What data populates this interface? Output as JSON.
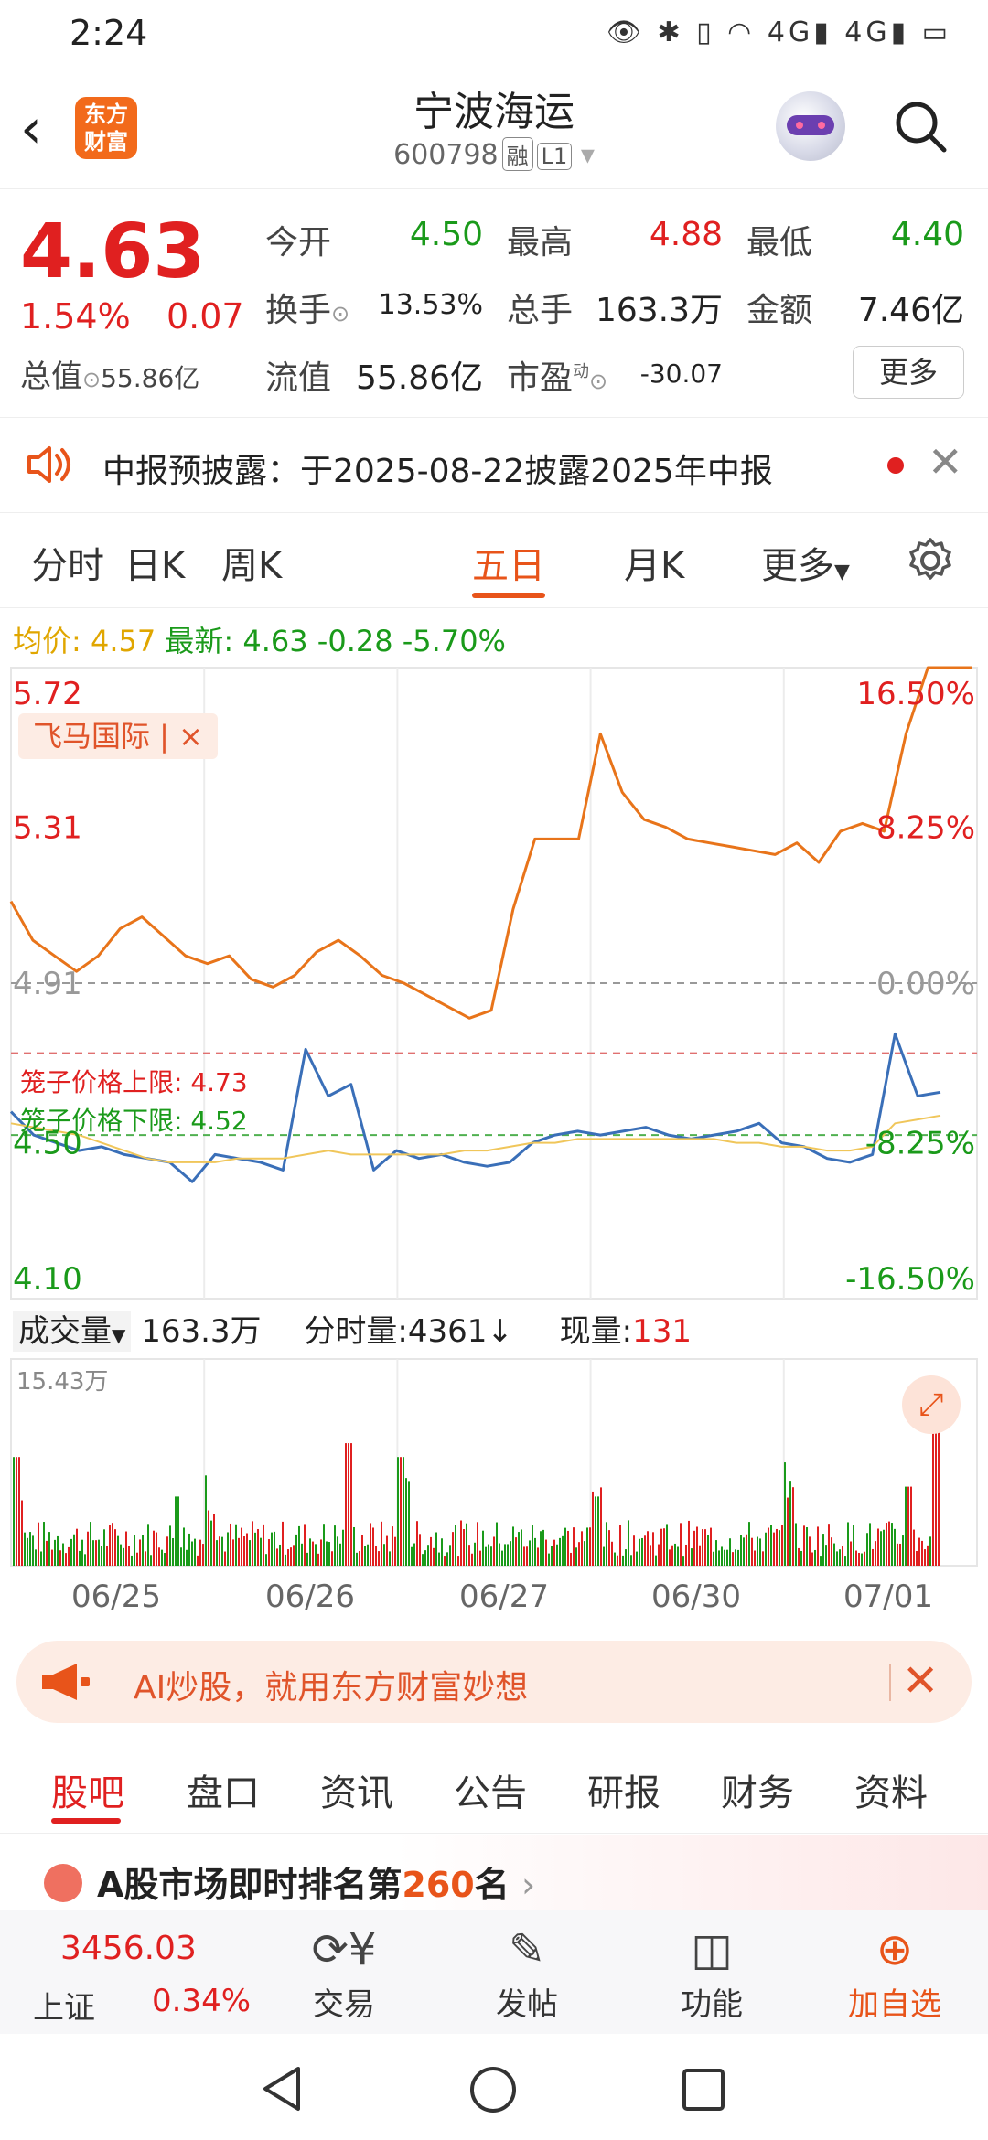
{
  "status_bar": {
    "time": "2:24"
  },
  "header": {
    "stock_name": "宁波海运",
    "stock_code": "600798",
    "tag_margin": "融",
    "tag_level": "L1",
    "logo_text": "东方财富"
  },
  "quote": {
    "price": "4.63",
    "change_pct": "1.54%",
    "change": "0.07",
    "total_value_label": "总值",
    "total_value": "55.86亿",
    "rows": {
      "open_label": "今开",
      "open": "4.50",
      "high_label": "最高",
      "high": "4.88",
      "low_label": "最低",
      "low": "4.40",
      "turnover_label": "换手",
      "turnover": "13.53%",
      "volume_label": "总手",
      "volume": "163.3万",
      "amount_label": "金额",
      "amount": "7.46亿",
      "float_label": "流值",
      "float": "55.86亿",
      "pe_label": "市盈",
      "pe_sup": "动",
      "pe": "-30.07"
    },
    "more_label": "更多"
  },
  "notice": {
    "text": "中报预披露：于2025-08-22披露2025年中报"
  },
  "tabs": [
    "分时",
    "日K",
    "周K",
    "五日",
    "月K",
    "更多"
  ],
  "active_tab": "五日",
  "avg_line": {
    "avg_label": "均价:",
    "avg": "4.57",
    "latest_label": "最新:",
    "latest": "4.63",
    "change": "-0.28",
    "change_pct": "-5.70%"
  },
  "chart_data": {
    "type": "line",
    "title": "",
    "x": [
      "06/25",
      "06/26",
      "06/27",
      "06/30",
      "07/01"
    ],
    "y_left_ticks": [
      "5.72",
      "5.31",
      "4.91",
      "4.50",
      "4.10"
    ],
    "y_right_ticks": [
      "16.50%",
      "8.25%",
      "0.00%",
      "-8.25%",
      "-16.50%"
    ],
    "ylim": [
      4.1,
      5.72
    ],
    "compare_badge": "飞马国际 | ×",
    "upper_limit_label": "笼子价格上限: 4.73",
    "lower_limit_label": "笼子价格下限: 4.52",
    "upper_limit": 4.73,
    "lower_limit": 4.52,
    "series": [
      {
        "name": "飞马国际",
        "color": "#e8741a",
        "values": [
          5.12,
          5.02,
          4.98,
          4.94,
          4.98,
          5.05,
          5.08,
          5.03,
          4.98,
          4.96,
          4.98,
          4.92,
          4.9,
          4.93,
          4.99,
          5.02,
          4.98,
          4.93,
          4.91,
          4.88,
          4.85,
          4.82,
          4.84,
          5.1,
          5.28,
          5.28,
          5.28,
          5.55,
          5.4,
          5.33,
          5.31,
          5.28,
          5.27,
          5.26,
          5.25,
          5.24,
          5.27,
          5.22,
          5.3,
          5.32,
          5.3,
          5.55,
          5.72,
          5.72,
          5.72
        ]
      },
      {
        "name": "宁波海运",
        "color": "#3a6fb8",
        "values": [
          4.58,
          4.52,
          4.5,
          4.48,
          4.49,
          4.47,
          4.46,
          4.45,
          4.4,
          4.47,
          4.46,
          4.45,
          4.43,
          4.74,
          4.62,
          4.65,
          4.43,
          4.48,
          4.46,
          4.47,
          4.45,
          4.44,
          4.45,
          4.5,
          4.52,
          4.53,
          4.52,
          4.53,
          4.54,
          4.52,
          4.51,
          4.52,
          4.53,
          4.55,
          4.5,
          4.49,
          4.46,
          4.45,
          4.47,
          4.78,
          4.62,
          4.63
        ]
      },
      {
        "name": "均价",
        "color": "#f0c65a",
        "values": [
          4.55,
          4.54,
          4.53,
          4.52,
          4.5,
          4.48,
          4.46,
          4.45,
          4.45,
          4.45,
          4.46,
          4.46,
          4.46,
          4.47,
          4.48,
          4.47,
          4.47,
          4.47,
          4.47,
          4.47,
          4.48,
          4.48,
          4.49,
          4.5,
          4.5,
          4.51,
          4.51,
          4.51,
          4.51,
          4.51,
          4.51,
          4.51,
          4.5,
          4.5,
          4.49,
          4.49,
          4.48,
          4.48,
          4.49,
          4.55,
          4.56,
          4.57
        ]
      }
    ],
    "volume": {
      "label": "成交量",
      "total": "163.3万",
      "fenshi_label": "分时量:4361",
      "now_label": "现量:",
      "now": "131",
      "max_label": "15.43万"
    }
  },
  "ai_banner": {
    "text": "AI炒股，就用东方财富妙想"
  },
  "bottom_tabs": [
    "股吧",
    "盘口",
    "资讯",
    "公告",
    "研报",
    "财务",
    "资料"
  ],
  "rank": {
    "prefix": "A股市场即时排名第",
    "num": "260",
    "suffix": "名"
  },
  "index": {
    "value": "3456.03",
    "name": "上证",
    "pct": "0.34%"
  },
  "nav": [
    {
      "label": "交易",
      "icon": "yen-cycle-icon"
    },
    {
      "label": "发帖",
      "icon": "edit-icon"
    },
    {
      "label": "功能",
      "icon": "grid-icon"
    },
    {
      "label": "加自选",
      "icon": "add-circle-icon"
    }
  ]
}
